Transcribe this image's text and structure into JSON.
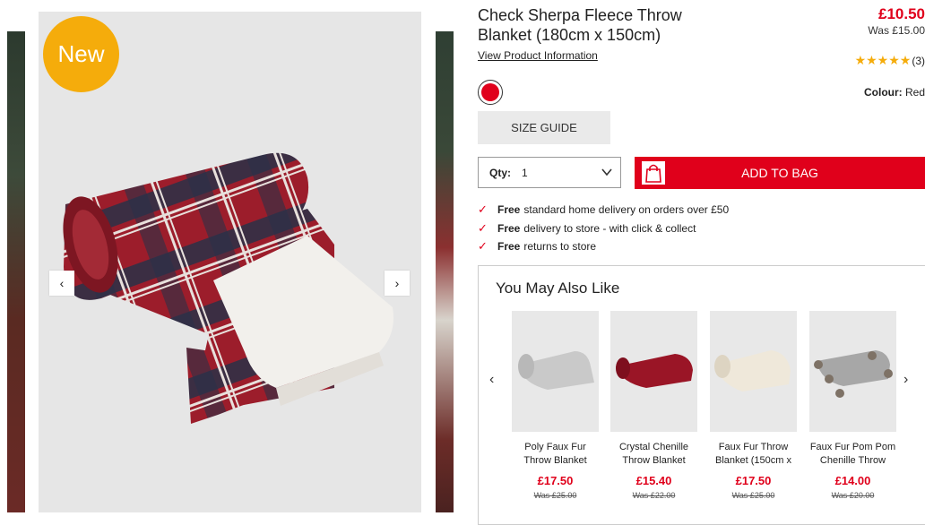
{
  "gallery": {
    "badge": "New",
    "prev_arrow": "‹",
    "next_arrow": "›"
  },
  "product": {
    "title": "Check Sherpa Fleece Throw Blanket (180cm x 150cm)",
    "price_now": "£10.50",
    "price_was": "Was £15.00",
    "view_info": "View Product Information",
    "rating_stars": "★★★★★",
    "rating_count": "(3)",
    "colour_label": "Colour:",
    "colour_value": "Red",
    "swatch_color": "#e0001b",
    "size_guide": "SIZE GUIDE",
    "qty_label": "Qty:",
    "qty_value": "1",
    "add_to_bag": "ADD TO BAG"
  },
  "perks": [
    {
      "bold": "Free",
      "text": "standard home delivery on orders over £50"
    },
    {
      "bold": "Free",
      "text": "delivery to store - with click & collect"
    },
    {
      "bold": "Free",
      "text": "returns to store"
    }
  ],
  "recommendations": {
    "title": "You May Also Like",
    "items": [
      {
        "name": "Poly Faux Fur Throw Blanket",
        "price": "£17.50",
        "was": "Was £25.00",
        "thumb_icon": "grey-throw"
      },
      {
        "name": "Crystal Chenille Throw Blanket",
        "price": "£15.40",
        "was": "Was £22.00",
        "thumb_icon": "red-throw"
      },
      {
        "name": "Faux Fur Throw Blanket (150cm x",
        "price": "£17.50",
        "was": "Was £25.00",
        "thumb_icon": "cream-throw"
      },
      {
        "name": "Faux Fur Pom Pom Chenille Throw",
        "price": "£14.00",
        "was": "Was £20.00",
        "thumb_icon": "grey-pompom-throw"
      }
    ]
  },
  "colors": {
    "accent_red": "#e0001b",
    "badge_orange": "#f5ac0b"
  }
}
